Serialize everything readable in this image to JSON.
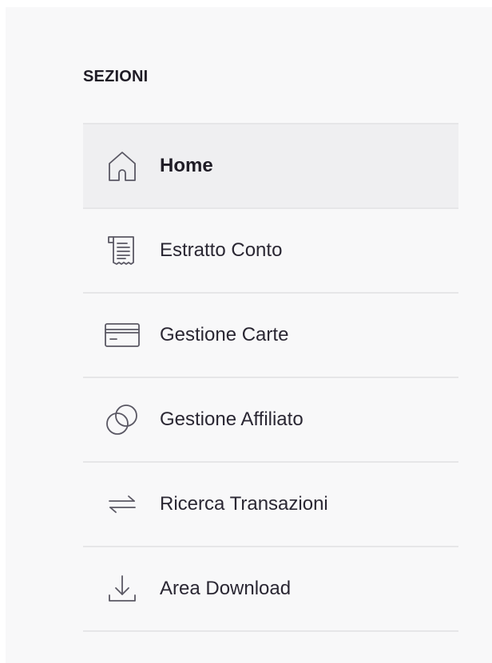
{
  "sidebar": {
    "section_title": "SEZIONI",
    "active_index": 0,
    "items": [
      {
        "label": "Home",
        "icon": "home-icon"
      },
      {
        "label": "Estratto Conto",
        "icon": "receipt-icon"
      },
      {
        "label": "Gestione Carte",
        "icon": "credit-card-icon"
      },
      {
        "label": "Gestione Affiliato",
        "icon": "overlapping-circles-icon"
      },
      {
        "label": "Ricerca Transazioni",
        "icon": "transfer-arrows-icon"
      },
      {
        "label": "Area Download",
        "icon": "download-icon"
      }
    ]
  },
  "colors": {
    "background": "#f8f8f9",
    "active_item_background": "#efeff1",
    "divider": "#e6e6e8",
    "text": "#2a2733",
    "icon_stroke": "#5a5864"
  }
}
